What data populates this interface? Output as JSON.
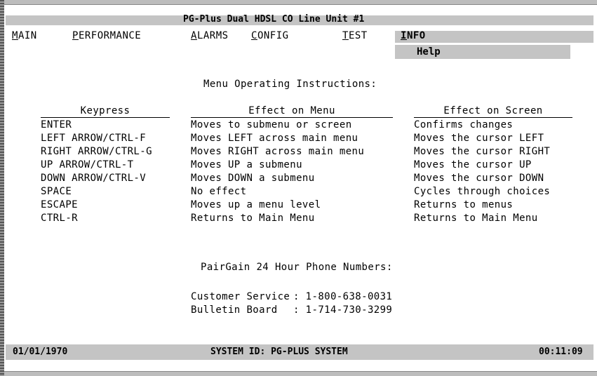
{
  "title": "PG-Plus Dual HDSL CO Line Unit #1",
  "menu": [
    {
      "accel": "M",
      "rest": "AIN"
    },
    {
      "accel": "P",
      "rest": "ERFORMANCE"
    },
    {
      "accel": "A",
      "rest": "LARMS"
    },
    {
      "accel": "C",
      "rest": "ONFIG"
    },
    {
      "accel": "T",
      "rest": "EST"
    },
    {
      "accel": "I",
      "rest": "NFO"
    }
  ],
  "submenu": {
    "item": "Help"
  },
  "heading": "Menu Operating Instructions:",
  "columns": {
    "keypress": "Keypress",
    "effect_menu": "Effect on Menu",
    "effect_screen": "Effect on Screen"
  },
  "rows": [
    {
      "key": "ENTER",
      "menu": "Moves to submenu or screen",
      "screen": "Confirms changes"
    },
    {
      "key": "LEFT ARROW/CTRL-F",
      "menu": "Moves LEFT across main menu",
      "screen": "Moves the cursor LEFT"
    },
    {
      "key": "RIGHT ARROW/CTRL-G",
      "menu": "Moves RIGHT across main menu",
      "screen": "Moves the cursor RIGHT"
    },
    {
      "key": "UP ARROW/CTRL-T",
      "menu": "Moves UP a submenu",
      "screen": "Moves the cursor UP"
    },
    {
      "key": "DOWN ARROW/CTRL-V",
      "menu": "Moves DOWN a submenu",
      "screen": "Moves the cursor DOWN"
    },
    {
      "key": "SPACE",
      "menu": "No effect",
      "screen": "Cycles through choices"
    },
    {
      "key": "ESCAPE",
      "menu": "Moves up a menu level",
      "screen": "Returns to menus"
    },
    {
      "key": "CTRL-R",
      "menu": "Returns to Main Menu",
      "screen": "Returns to Main Menu"
    }
  ],
  "phone": {
    "heading": "PairGain 24 Hour Phone Numbers:",
    "customer_label": "Customer Service",
    "customer_number": ": 1-800-638-0031",
    "bulletin_label": "Bulletin Board",
    "bulletin_number": ": 1-714-730-3299"
  },
  "status": {
    "date": "01/01/1970",
    "system_id": "SYSTEM ID: PG-PLUS SYSTEM",
    "time": "00:11:09"
  }
}
